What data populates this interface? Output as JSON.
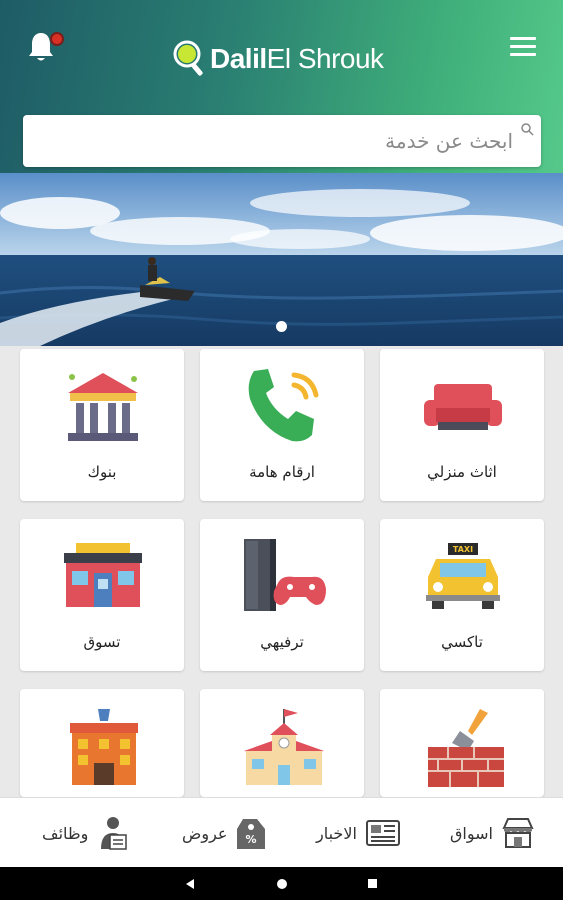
{
  "header": {
    "app_name_bold": "Dalil",
    "app_name_rest": "El Shrouk",
    "notification_icon": "bell-icon",
    "menu_icon": "hamburger-menu-icon",
    "brand_gradient": [
      "#1e5b66",
      "#55c98a"
    ]
  },
  "search": {
    "placeholder": "ابحث عن خدمة",
    "value": ""
  },
  "banner": {
    "image": "jet-ski-on-sea-photo",
    "slide_indicator_count": 1,
    "active_slide": 1
  },
  "categories": [
    {
      "label": "اثاث منزلي",
      "icon": "sofa-icon"
    },
    {
      "label": "ارقام هامة",
      "icon": "phone-icon"
    },
    {
      "label": "بنوك",
      "icon": "bank-icon"
    },
    {
      "label": "تاكسي",
      "icon": "taxi-icon"
    },
    {
      "label": "ترفيهي",
      "icon": "game-console-icon"
    },
    {
      "label": "تسوق",
      "icon": "shop-icon"
    },
    {
      "label": "",
      "icon": "construction-bricks-icon"
    },
    {
      "label": "",
      "icon": "school-icon"
    },
    {
      "label": "",
      "icon": "hotel-building-icon"
    }
  ],
  "taxi_sign": "TAXI",
  "bottom_nav": [
    {
      "label": "اسواق",
      "icon": "market-stall-icon"
    },
    {
      "label": "الاخبار",
      "icon": "newspaper-icon"
    },
    {
      "label": "عروض",
      "icon": "offer-tag-icon"
    },
    {
      "label": "وظائف",
      "icon": "job-person-icon"
    }
  ],
  "system_nav": {
    "back": "back-icon",
    "home": "home-icon",
    "recents": "recents-icon"
  }
}
